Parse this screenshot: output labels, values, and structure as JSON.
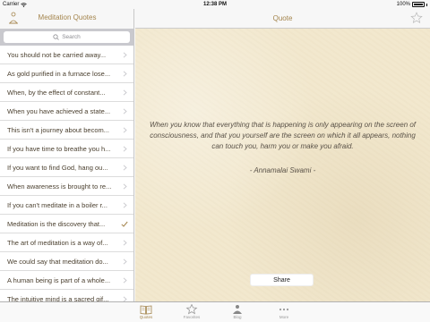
{
  "status": {
    "carrier": "Carrier",
    "time": "12:38 PM",
    "battery": "100%"
  },
  "sidebar": {
    "title": "Meditation Quotes",
    "search_placeholder": "Search",
    "quotes": [
      "You should not be carried away...",
      "As gold purified in a furnace lose...",
      "When, by the effect of constant...",
      "When you have achieved a state...",
      "This isn't a journey about becom...",
      "If you have time to breathe you h...",
      "If you want to find God, hang ou...",
      "When awareness is brought to re...",
      "If you can't meditate in a boiler r...",
      "Meditation is the discovery that...",
      "The art of meditation is a way of...",
      "We could say that meditation do...",
      "A human being is part of a whole...",
      "The intuitive mind is a sacred gif..."
    ],
    "selected_index": 9
  },
  "detail": {
    "title": "Quote",
    "quote": "When you know that everything that is happening is only appearing on the screen of consciousness, and that you yourself are the screen on which it all appears, nothing can touch you, harm you or make you afraid.",
    "author": "-  Annamalai Swami  -",
    "share_label": "Share"
  },
  "tabs": [
    {
      "label": "Quotes",
      "icon": "book-icon",
      "active": true
    },
    {
      "label": "Favorites",
      "icon": "star-icon",
      "active": false
    },
    {
      "label": "Blog",
      "icon": "person-icon",
      "active": false
    },
    {
      "label": "More",
      "icon": "more-icon",
      "active": false
    }
  ],
  "colors": {
    "accent": "#a4854d",
    "paper": "#f2e8ce"
  }
}
